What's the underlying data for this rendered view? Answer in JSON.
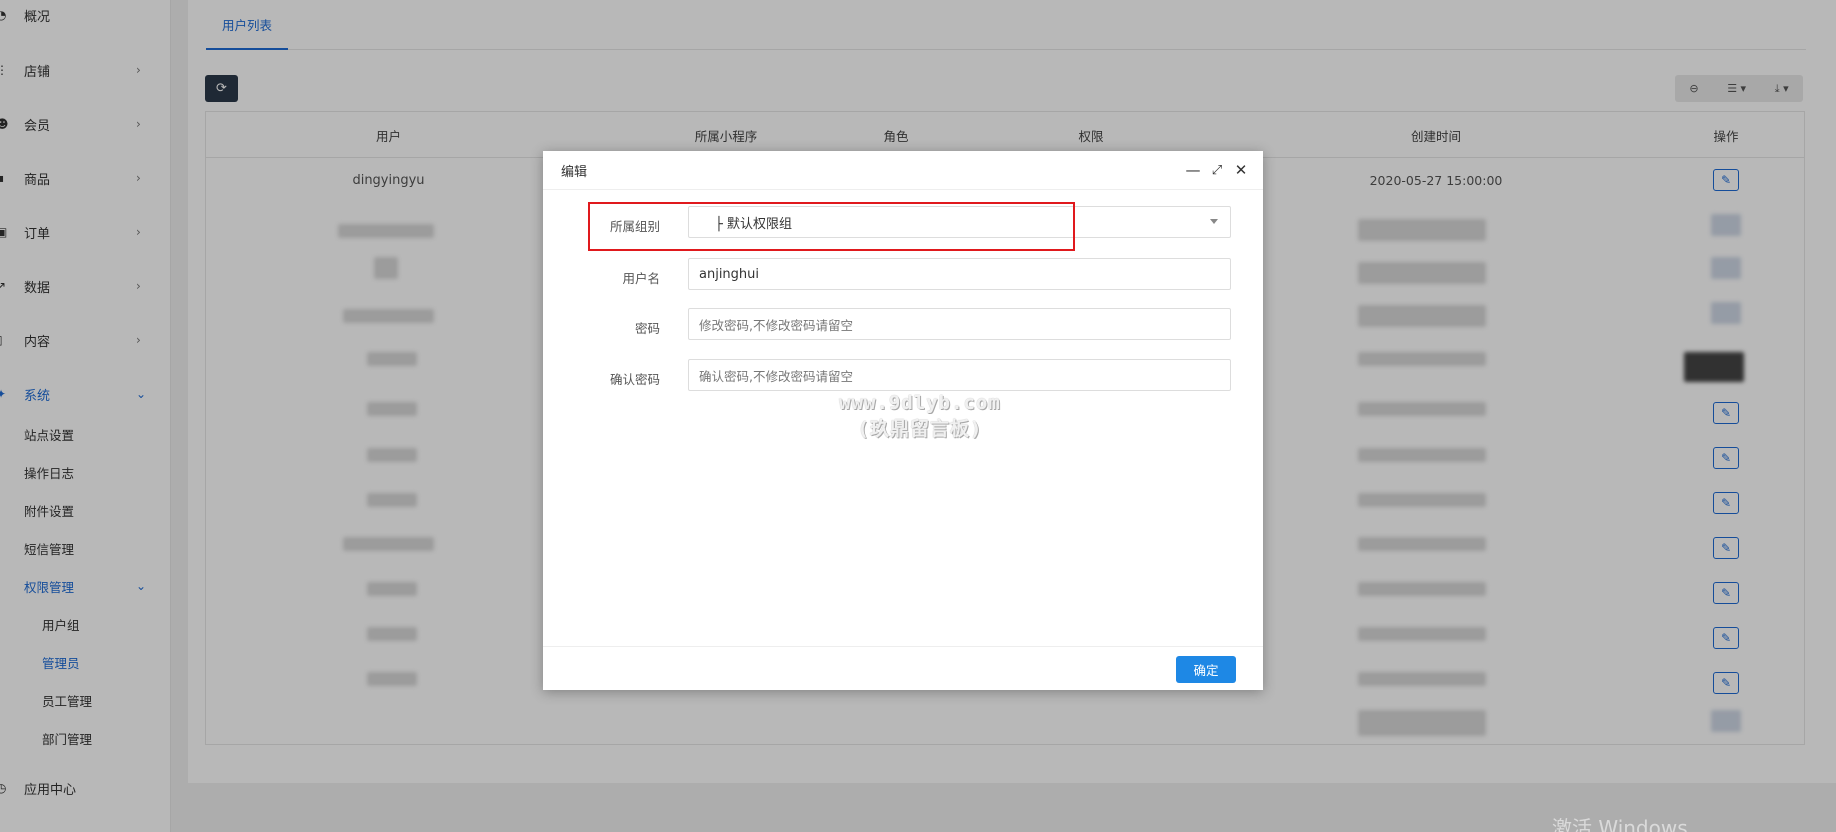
{
  "sidebar": {
    "items": [
      {
        "label": "概况",
        "icon": "dashboard-icon"
      },
      {
        "label": "店铺",
        "icon": "store-icon"
      },
      {
        "label": "会员",
        "icon": "members-icon"
      },
      {
        "label": "商品",
        "icon": "goods-icon"
      },
      {
        "label": "订单",
        "icon": "orders-icon"
      },
      {
        "label": "数据",
        "icon": "chart-icon"
      },
      {
        "label": "内容",
        "icon": "content-icon"
      },
      {
        "label": "系统",
        "icon": "system-icon"
      }
    ],
    "system_sub": [
      "站点设置",
      "操作日志",
      "附件设置",
      "短信管理",
      "权限管理"
    ],
    "permission_sub": [
      "用户组",
      "管理员",
      "员工管理",
      "部门管理"
    ],
    "app_center": "应用中心"
  },
  "main": {
    "tab": "用户列表",
    "columns": [
      "用户",
      "所属小程序",
      "角色",
      "权限",
      "创建时间",
      "操作"
    ],
    "first_row": {
      "user": "dingyingyu",
      "created": "2020-05-27 15:00:00"
    }
  },
  "dialog": {
    "title": "编辑",
    "group_label": "所属组别",
    "group_value": "├ 默认权限组",
    "username_label": "用户名",
    "username_value": "anjinghui",
    "password_label": "密码",
    "password_placeholder": "修改密码,不修改密码请留空",
    "confirm_label": "确认密码",
    "confirm_placeholder": "确认密码,不修改密码请留空",
    "ok_label": "确定"
  },
  "watermark": {
    "line1": "www.9dlyb.com",
    "line2": "(玖鼎留言板)"
  },
  "os_watermark": "激活 Windows",
  "colors": {
    "accent": "#1e6bd6",
    "primary_button": "#1e88e5",
    "highlight": "#e0191d"
  }
}
